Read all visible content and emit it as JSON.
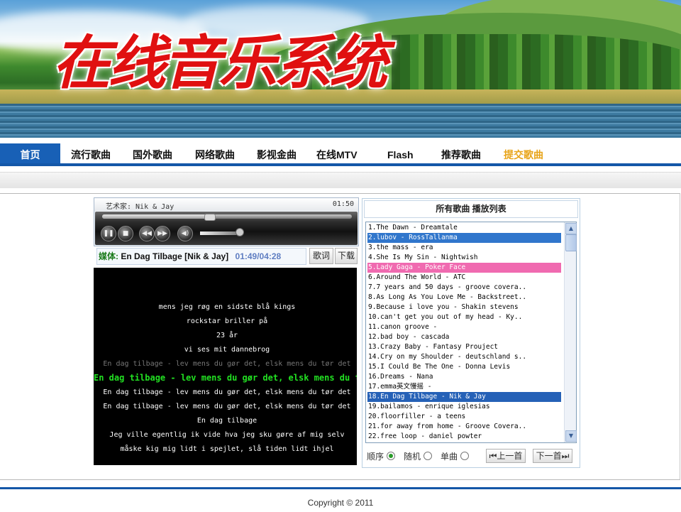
{
  "banner": {
    "logo_text": "在线音乐系统"
  },
  "nav": {
    "items": [
      "首页",
      "流行歌曲",
      "国外歌曲",
      "网络歌曲",
      "影视金曲",
      "在线MTV",
      "Flash",
      "推荐歌曲",
      "提交歌曲"
    ],
    "active": "首页"
  },
  "player": {
    "artist": "艺术家: Nik & Jay",
    "time": "01:50",
    "progress_fraction": 0.43,
    "icons": [
      "pause-icon",
      "stop-icon",
      "prev-icon",
      "next-icon",
      "volume-icon"
    ]
  },
  "media": {
    "label": "媒体:",
    "song": "En Dag Tilbage [Nik & Jay]",
    "position": "01:49/04:28",
    "lyrics_button": "歌词",
    "download_button": "下载"
  },
  "lyrics": {
    "lines": [
      "mens jeg røg en sidste blå kings",
      "rockstar briller på",
      "23 år",
      "vi ses mit dannebrog",
      "En dag tilbage - lev mens du gør det, elsk mens du tør det",
      "En dag tilbage - lev mens du gør det, elsk mens du tør det",
      "En dag tilbage - lev mens du gør det, elsk mens du tør det",
      "En dag tilbage - lev mens du gør det, elsk mens du tør det",
      "En dag tilbage",
      "Jeg ville egentlig ik vide hva jeg sku gøre af mig selv",
      "måske kig mig lidt i spejlet, slå tiden lidt ihjel"
    ],
    "current_index": 5,
    "dim_index": 4
  },
  "playlist": {
    "header": "所有歌曲  播放列表",
    "songs": [
      "1.The Dawn - Dreamtale",
      "2.lubov - RossTallanma",
      "3.the mass - era",
      "4.She Is My Sin - Nightwish",
      "5.Lady Gaga - Poker Face",
      "6.Around The World - ATC",
      "7.7 years and 50 days - groove covera..",
      "8.As Long As You Love Me - Backstreet..",
      "9.Because i love you - Shakin stevens",
      "10.can't get you out of my head - Ky..",
      "11.canon groove -",
      "12.bad boy - cascada",
      "13.Crazy Baby - Fantasy Prouject",
      "14.Cry on my Shoulder - deutschland s..",
      "15.I Could Be The One - Donna Levis",
      "16.Dreams - Nana",
      "17.emma英文慢摇 -",
      "18.En Dag Tilbage - Nik & Jay",
      "19.bailamos - enrique iglesias",
      "20.floorfiller - a teens",
      "21.for away from home - Groove Covera..",
      "22.free loop - daniel powter"
    ],
    "selected_index": 1,
    "highlight_index": 4,
    "playing_index": 17,
    "modes": [
      "顺序",
      "随机",
      "单曲"
    ],
    "mode_selected": 0,
    "prev_button": "上一首",
    "next_button": "下一首"
  },
  "footer": {
    "copyright": "Copyright © 2011"
  },
  "colors": {
    "nav_blue": "#1860b6",
    "submit_orange": "#e8a418",
    "lyric_current": "#22e022",
    "media_label": "#1a7a1a",
    "playlist_select": "#3076cc",
    "playlist_pink": "#f06ab0"
  }
}
